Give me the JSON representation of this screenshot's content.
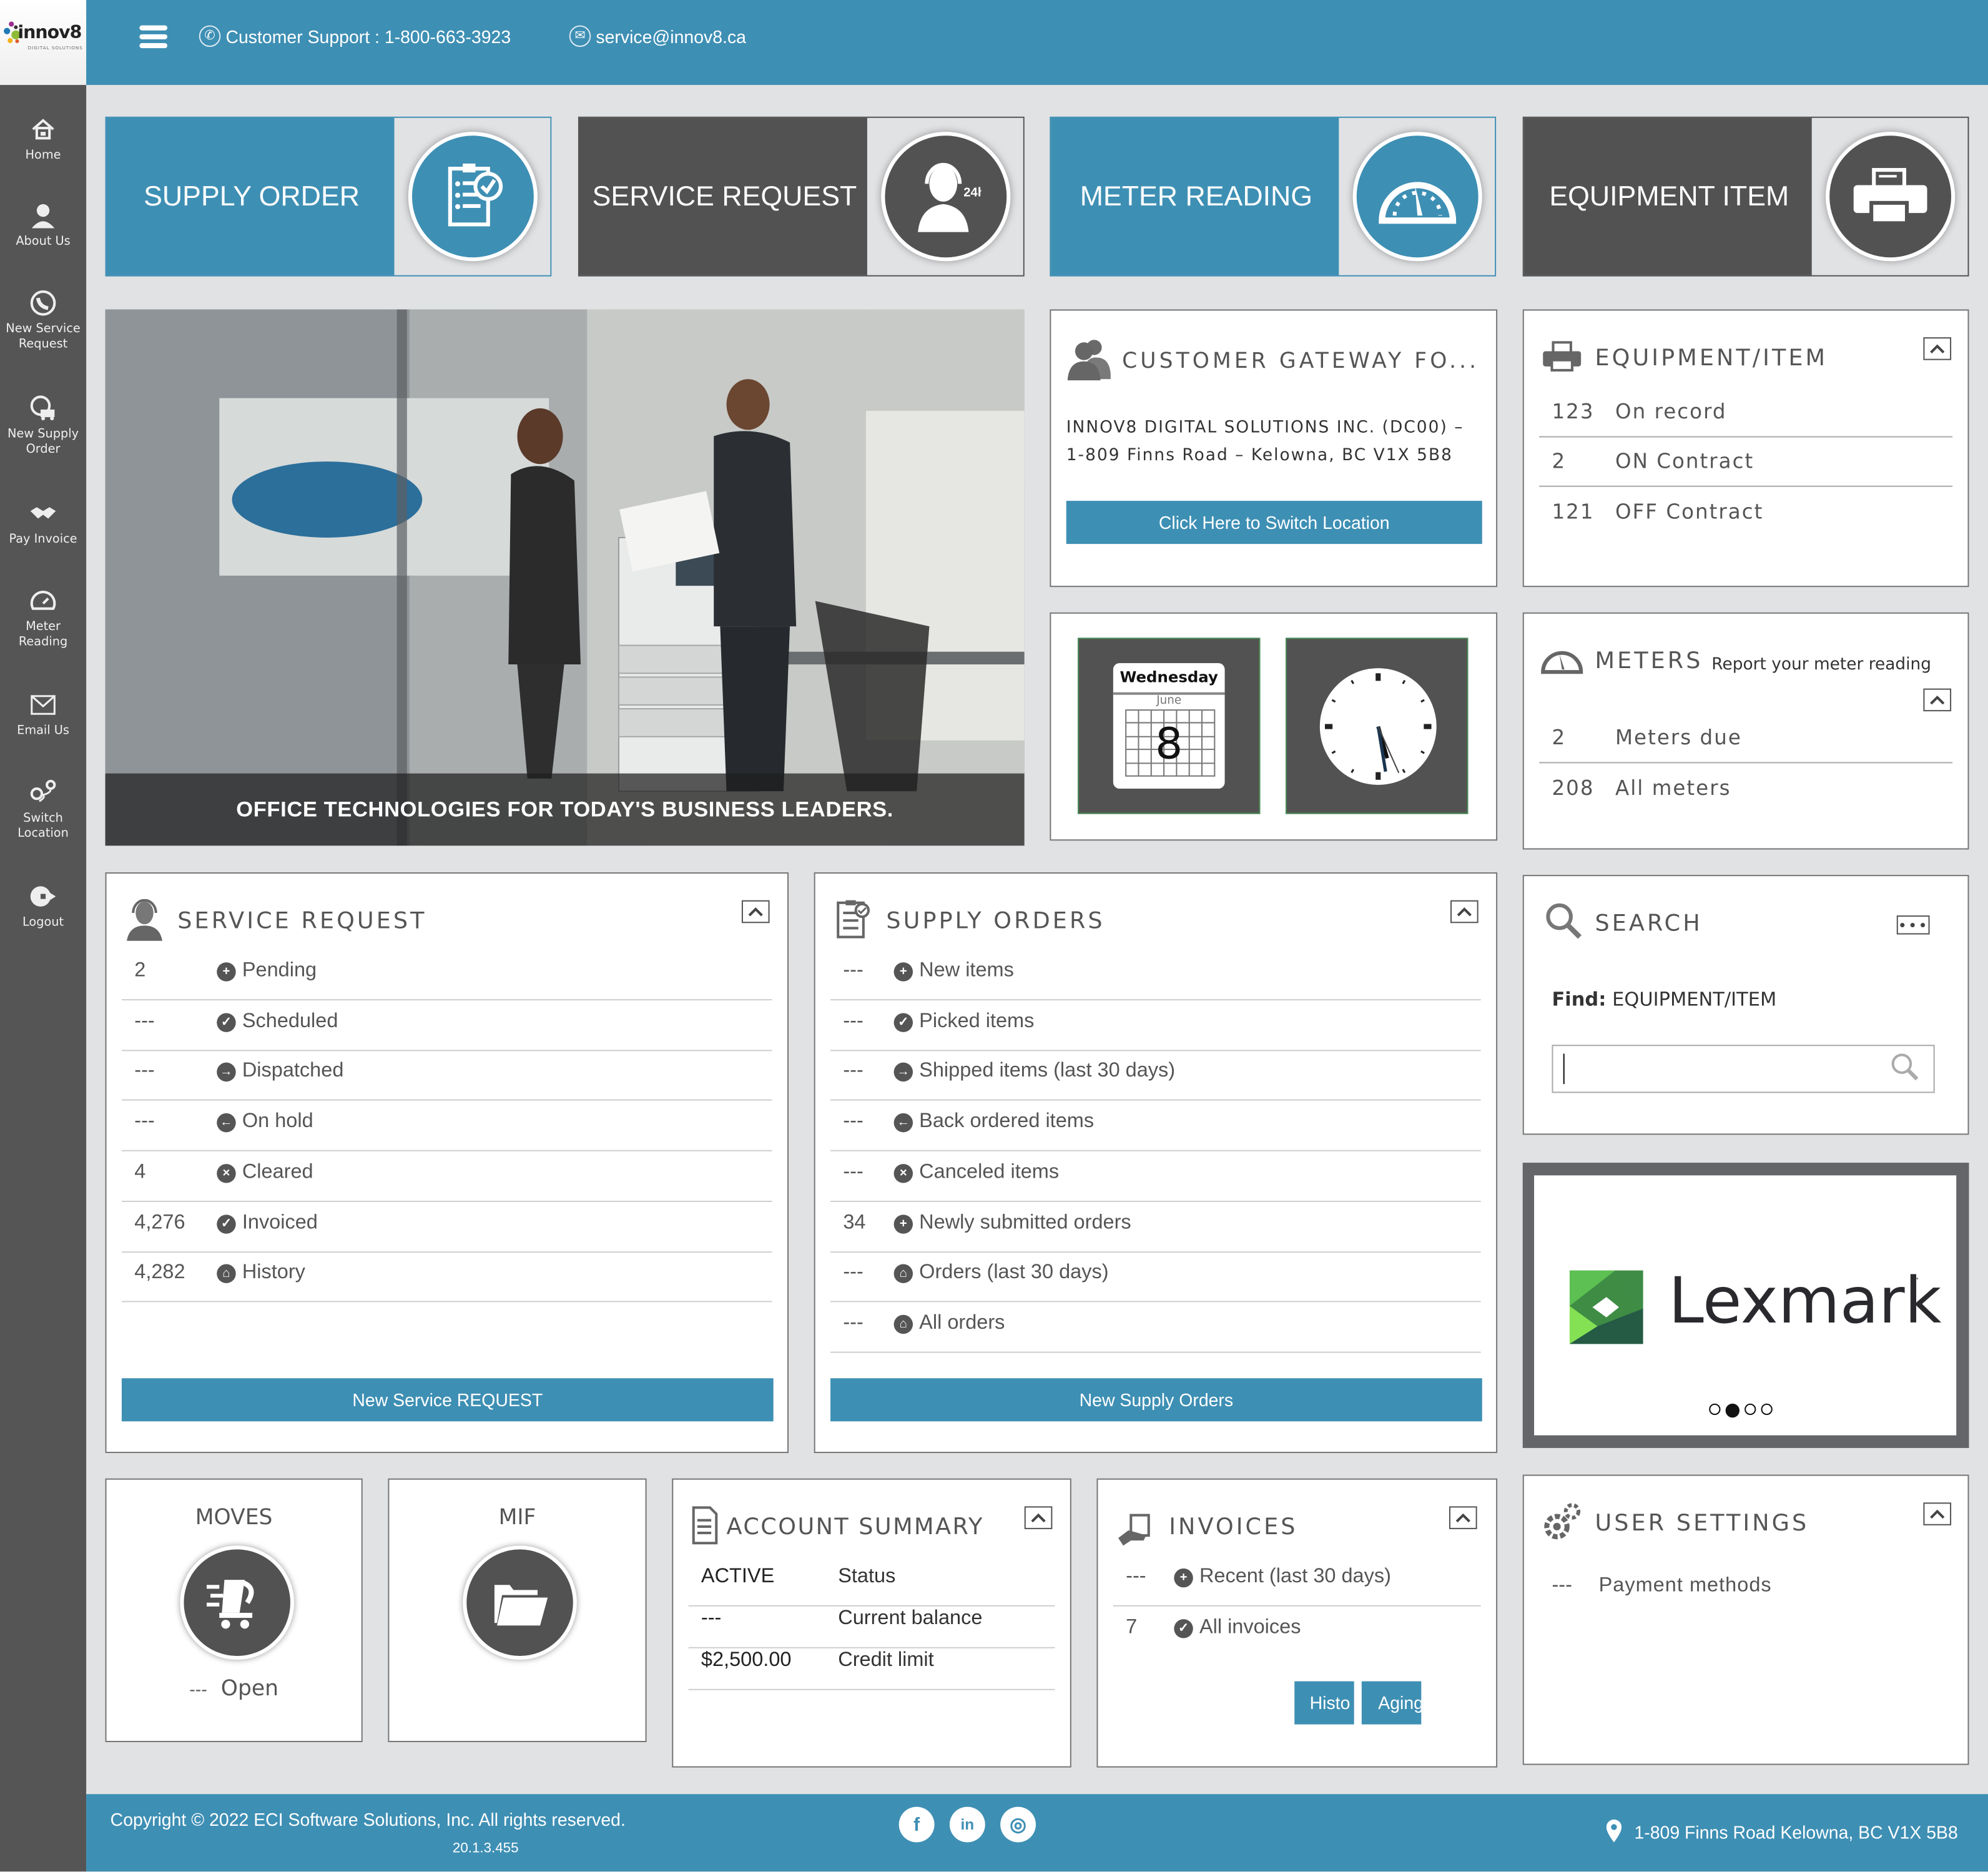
{
  "brand": {
    "logo_text": "innov8",
    "logo_subtext": "DIGITAL SOLUTIONS",
    "accent_color": "#3e8fb4",
    "dark_color": "#525252"
  },
  "topbar": {
    "menu_icon": "hamburger-icon",
    "support_label": "Customer Support : 1-800-663-3923",
    "email_label": "service@innov8.ca"
  },
  "sidebar": {
    "items": [
      {
        "label": "Home",
        "icon": "home-icon"
      },
      {
        "label": "About Us",
        "icon": "person-icon"
      },
      {
        "label": "New Service Request",
        "icon": "phone-icon"
      },
      {
        "label": "New Supply Order",
        "icon": "delivery-truck-icon"
      },
      {
        "label": "Pay Invoice",
        "icon": "handshake-icon"
      },
      {
        "label": "Meter Reading",
        "icon": "gauge-icon"
      },
      {
        "label": "Email Us",
        "icon": "envelope-icon"
      },
      {
        "label": "Switch Location",
        "icon": "location-route-icon"
      },
      {
        "label": "Logout",
        "icon": "logout-icon"
      }
    ]
  },
  "tiles": [
    {
      "label": "SUPPLY ORDER",
      "icon": "clipboard-check-icon",
      "style": "blue"
    },
    {
      "label": "SERVICE REQUEST",
      "icon": "support-agent-24h-icon",
      "style": "dark"
    },
    {
      "label": "METER READING",
      "icon": "speedometer-icon",
      "style": "blue"
    },
    {
      "label": "EQUIPMENT ITEM",
      "icon": "printer-icon",
      "style": "dark"
    }
  ],
  "hero": {
    "caption": "OFFICE TECHNOLOGIES FOR TODAY'S BUSINESS LEADERS."
  },
  "customer_gateway": {
    "title": "CUSTOMER GATEWAY FO...",
    "address_line1": "INNOV8 DIGITAL SOLUTIONS INC. (DC00) –",
    "address_line2": "1-809 Finns Road – Kelowna, BC V1X 5B8",
    "switch_button": "Click Here to Switch Location"
  },
  "date_widget": {
    "weekday": "Wednesday",
    "month": "June",
    "day": "8"
  },
  "clock_widget": {
    "hour": 5,
    "minute": 28,
    "second": 26
  },
  "equipment": {
    "title": "EQUIPMENT/ITEM",
    "rows": [
      {
        "count": "123",
        "label": "On record"
      },
      {
        "count": "2",
        "label": "ON Contract"
      },
      {
        "count": "121",
        "label": "OFF Contract"
      }
    ]
  },
  "meters": {
    "title": "METERS",
    "subtitle": "Report your meter reading",
    "rows": [
      {
        "count": "2",
        "label": "Meters due"
      },
      {
        "count": "208",
        "label": "All meters"
      }
    ]
  },
  "service_request": {
    "title": "SERVICE REQUEST",
    "rows": [
      {
        "count": "2",
        "label": "Pending",
        "icon": "plus-circle-icon",
        "glyph": "+"
      },
      {
        "count": "---",
        "label": "Scheduled",
        "icon": "check-circle-icon",
        "glyph": "✓"
      },
      {
        "count": "---",
        "label": "Dispatched",
        "icon": "arrow-right-circle-icon",
        "glyph": "→"
      },
      {
        "count": "---",
        "label": "On hold",
        "icon": "arrow-left-circle-icon",
        "glyph": "←"
      },
      {
        "count": "4",
        "label": "Cleared",
        "icon": "x-circle-icon",
        "glyph": "×"
      },
      {
        "count": "4,276",
        "label": "Invoiced",
        "icon": "check-circle-icon",
        "glyph": "✓"
      },
      {
        "count": "4,282",
        "label": "History",
        "icon": "cart-circle-icon",
        "glyph": "⌂"
      }
    ],
    "button": "New Service REQUEST"
  },
  "supply_orders": {
    "title": "SUPPLY ORDERS",
    "rows": [
      {
        "count": "---",
        "label": "New items",
        "icon": "plus-circle-icon",
        "glyph": "+"
      },
      {
        "count": "---",
        "label": "Picked items",
        "icon": "check-circle-icon",
        "glyph": "✓"
      },
      {
        "count": "---",
        "label": "Shipped items (last 30 days)",
        "icon": "arrow-right-circle-icon",
        "glyph": "→"
      },
      {
        "count": "---",
        "label": "Back ordered items",
        "icon": "arrow-left-circle-icon",
        "glyph": "←"
      },
      {
        "count": "---",
        "label": "Canceled items",
        "icon": "x-circle-icon",
        "glyph": "×"
      },
      {
        "count": "34",
        "label": "Newly submitted orders",
        "icon": "plus-circle-icon",
        "glyph": "+"
      },
      {
        "count": "---",
        "label": "Orders (last 30 days)",
        "icon": "cart-circle-icon",
        "glyph": "⌂"
      },
      {
        "count": "---",
        "label": "All orders",
        "icon": "cart-circle-icon",
        "glyph": "⌂"
      }
    ],
    "button": "New Supply Orders"
  },
  "search": {
    "title": "SEARCH",
    "find_label": "Find:",
    "find_value": "EQUIPMENT/ITEM",
    "input_value": "",
    "input_placeholder": ""
  },
  "carousel": {
    "brand": "Lexmark",
    "trademark": "™",
    "slide_count": 4,
    "active_slide": 2
  },
  "moves": {
    "title": "MOVES",
    "count": "---",
    "label": "Open"
  },
  "mif": {
    "title": "MIF"
  },
  "account_summary": {
    "title": "ACCOUNT SUMMARY",
    "rows": [
      {
        "value": "ACTIVE",
        "label": "Status"
      },
      {
        "value": "---",
        "label": "Current balance"
      },
      {
        "value": "$2,500.00",
        "label": "Credit limit"
      }
    ]
  },
  "invoices": {
    "title": "INVOICES",
    "rows": [
      {
        "count": "---",
        "label": "Recent (last 30 days)",
        "glyph": "+"
      },
      {
        "count": "7",
        "label": "All invoices",
        "glyph": "✓"
      }
    ],
    "history_button": "Histo",
    "aging_button": "Aging"
  },
  "user_settings": {
    "title": "USER SETTINGS",
    "rows": [
      {
        "count": "---",
        "label": "Payment methods"
      }
    ]
  },
  "footer": {
    "copyright": "Copyright © 2022 ECI Software Solutions, Inc. All rights reserved.",
    "version": "20.1.3.455",
    "social": [
      {
        "name": "facebook",
        "glyph": "f"
      },
      {
        "name": "linkedin",
        "glyph": "in"
      },
      {
        "name": "instagram",
        "glyph": "◎"
      }
    ],
    "address": "1-809 Finns Road Kelowna, BC V1X 5B8"
  }
}
